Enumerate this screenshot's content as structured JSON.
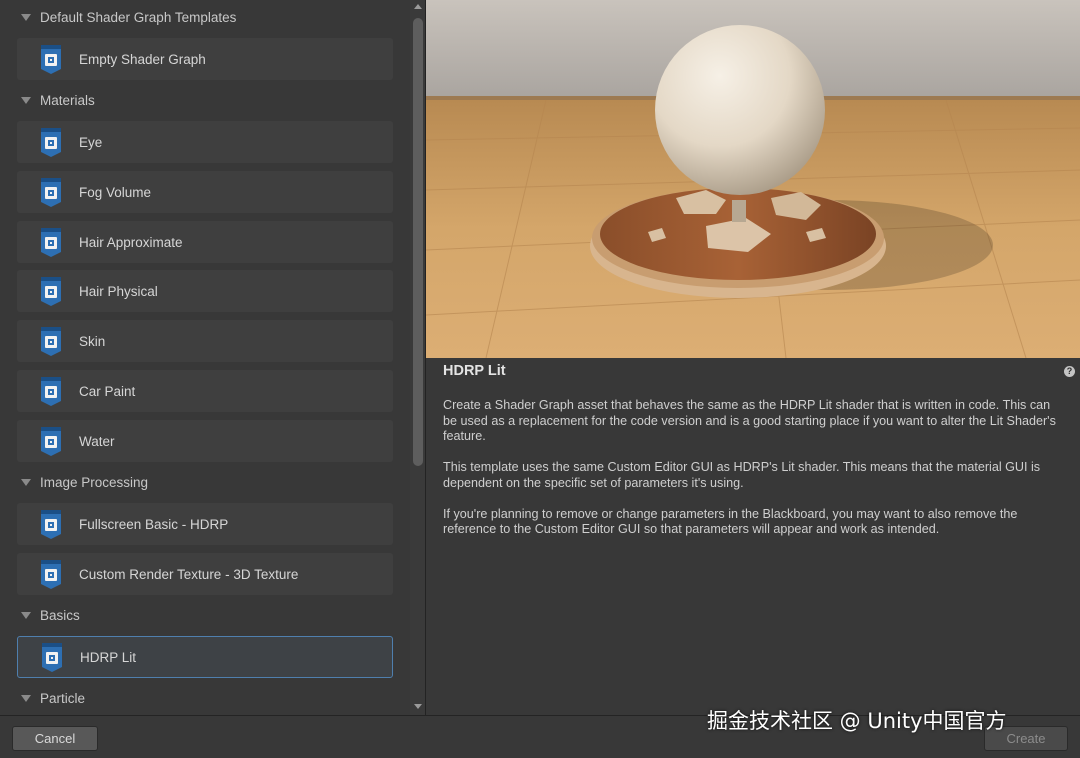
{
  "groups": [
    {
      "label": "Default Shader Graph Templates",
      "items": [
        {
          "label": "Empty Shader Graph"
        }
      ]
    },
    {
      "label": "Materials",
      "items": [
        {
          "label": "Eye"
        },
        {
          "label": "Fog Volume"
        },
        {
          "label": "Hair Approximate"
        },
        {
          "label": "Hair Physical"
        },
        {
          "label": "Skin"
        },
        {
          "label": "Car Paint"
        },
        {
          "label": "Water"
        }
      ]
    },
    {
      "label": "Image Processing",
      "items": [
        {
          "label": "Fullscreen Basic - HDRP"
        },
        {
          "label": "Custom Render Texture - 3D Texture"
        }
      ]
    },
    {
      "label": "Basics",
      "items": [
        {
          "label": "HDRP Lit",
          "selected": true
        }
      ]
    },
    {
      "label": "Particle",
      "items": []
    }
  ],
  "detail": {
    "title": "HDRP Lit",
    "help": "?",
    "paragraphs": [
      "Create a Shader Graph asset that behaves the same as the HDRP Lit shader that is written in code. This can be used as a replacement for the code version and is a good starting place if you want to alter the Lit Shader's feature.",
      "This template uses the same Custom Editor GUI as HDRP's Lit shader. This means that the material GUI is dependent on the specific set of parameters it's using.",
      "If you're planning to remove or change parameters in the Blackboard, you may want to also remove the reference to the Custom Editor GUI so that parameters will appear and work as intended."
    ]
  },
  "footer": {
    "cancel_label": "Cancel",
    "create_label": "Create"
  },
  "watermark": "掘金技术社区 @ Unity中国官方",
  "colors": {
    "selected_border": "#4f7fae",
    "icon_blue": "#2d6fb3",
    "panel": "#383838",
    "item": "#3f3f3f"
  }
}
